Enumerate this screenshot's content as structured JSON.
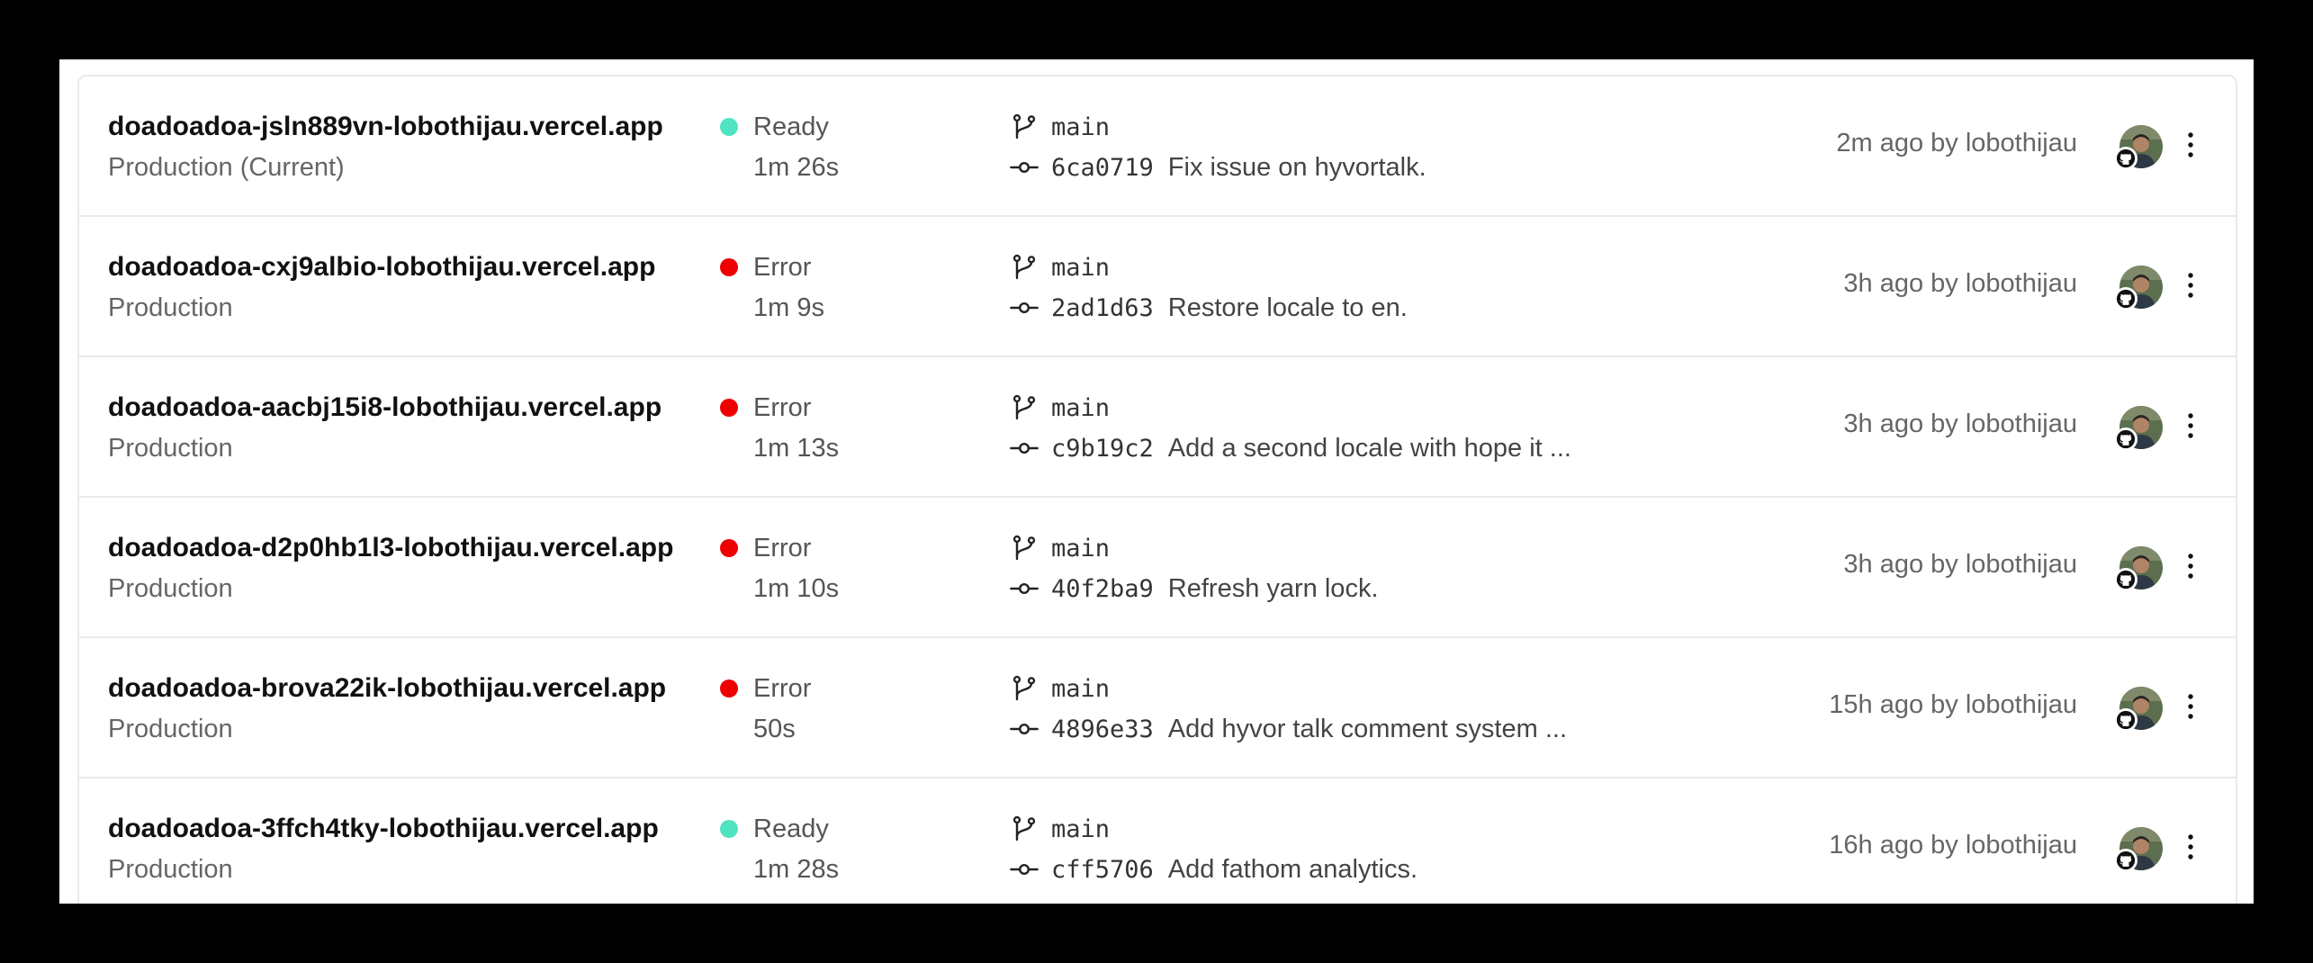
{
  "colors": {
    "ready": "#50e3c2",
    "error": "#ee0000"
  },
  "deployments": [
    {
      "url": "doadoadoa-jsln889vn-lobothijau.vercel.app",
      "environment": "Production (Current)",
      "status": "Ready",
      "status_color": "#50e3c2",
      "duration": "1m 26s",
      "branch": "main",
      "commit_hash": "6ca0719",
      "commit_message": "Fix issue on hyvortalk.",
      "meta": "2m ago by lobothijau"
    },
    {
      "url": "doadoadoa-cxj9albio-lobothijau.vercel.app",
      "environment": "Production",
      "status": "Error",
      "status_color": "#ee0000",
      "duration": "1m 9s",
      "branch": "main",
      "commit_hash": "2ad1d63",
      "commit_message": "Restore locale to en.",
      "meta": "3h ago by lobothijau"
    },
    {
      "url": "doadoadoa-aacbj15i8-lobothijau.vercel.app",
      "environment": "Production",
      "status": "Error",
      "status_color": "#ee0000",
      "duration": "1m 13s",
      "branch": "main",
      "commit_hash": "c9b19c2",
      "commit_message": "Add a second locale with hope it ...",
      "meta": "3h ago by lobothijau"
    },
    {
      "url": "doadoadoa-d2p0hb1l3-lobothijau.vercel.app",
      "environment": "Production",
      "status": "Error",
      "status_color": "#ee0000",
      "duration": "1m 10s",
      "branch": "main",
      "commit_hash": "40f2ba9",
      "commit_message": "Refresh yarn lock.",
      "meta": "3h ago by lobothijau"
    },
    {
      "url": "doadoadoa-brova22ik-lobothijau.vercel.app",
      "environment": "Production",
      "status": "Error",
      "status_color": "#ee0000",
      "duration": "50s",
      "branch": "main",
      "commit_hash": "4896e33",
      "commit_message": "Add hyvor talk comment system ...",
      "meta": "15h ago by lobothijau"
    },
    {
      "url": "doadoadoa-3ffch4tky-lobothijau.vercel.app",
      "environment": "Production",
      "status": "Ready",
      "status_color": "#50e3c2",
      "duration": "1m 28s",
      "branch": "main",
      "commit_hash": "cff5706",
      "commit_message": "Add fathom analytics.",
      "meta": "16h ago by lobothijau"
    }
  ]
}
